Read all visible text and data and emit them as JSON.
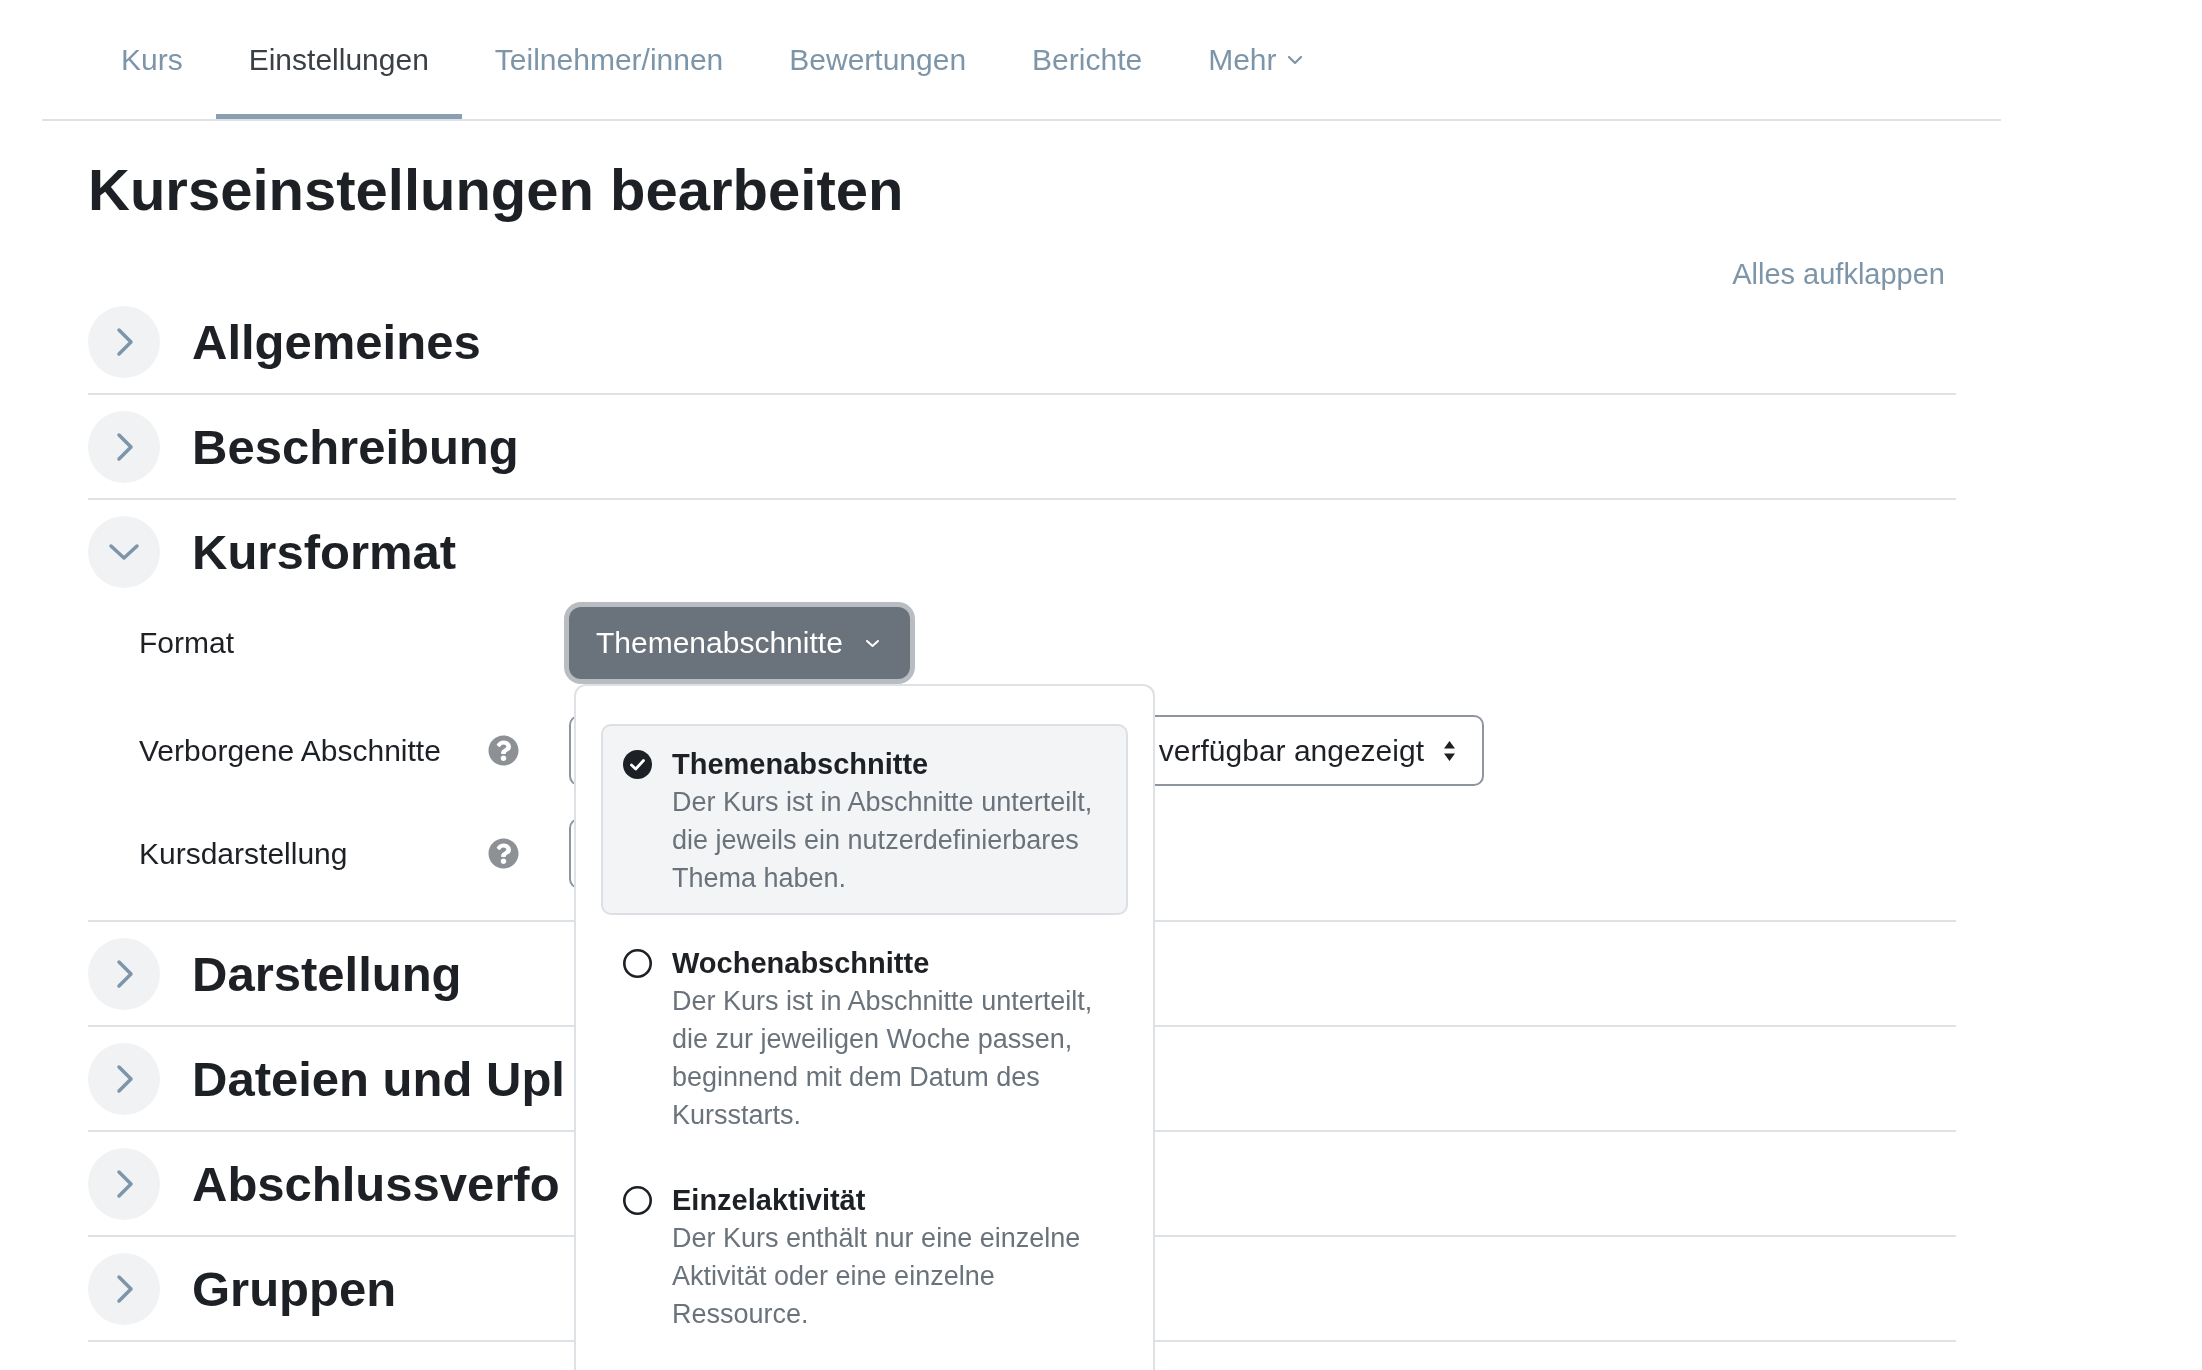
{
  "tabs": [
    {
      "label": "Kurs",
      "selected": false,
      "kind": "link"
    },
    {
      "label": "Einstellungen",
      "selected": true,
      "kind": "link"
    },
    {
      "label": "Teilnehmer/innen",
      "selected": false,
      "kind": "link"
    },
    {
      "label": "Bewertungen",
      "selected": false,
      "kind": "link"
    },
    {
      "label": "Berichte",
      "selected": false,
      "kind": "link"
    },
    {
      "label": "Mehr",
      "selected": false,
      "kind": "menu"
    }
  ],
  "page_title": "Kurseinstellungen bearbeiten",
  "expand_all_link": "Alles aufklappen",
  "sections": [
    {
      "title": "Allgemeines",
      "expanded": false
    },
    {
      "title": "Beschreibung",
      "expanded": false
    },
    {
      "title": "Kursformat",
      "expanded": true,
      "fields": [
        {
          "label": "Format",
          "help": false,
          "control": {
            "kind": "menu-button",
            "value": "Themenabschnitte",
            "expanded": true,
            "options": [
              {
                "title": "Themenabschnitte",
                "description": "Der Kurs ist in Abschnitte unterteilt, die jeweils ein nutzerdefinierbares Thema haben.",
                "selected": true
              },
              {
                "title": "Wochenabschnitte",
                "description": "Der Kurs ist in Abschnitte unterteilt, die zur jeweiligen Woche passen, beginnend mit dem Datum des Kursstarts.",
                "selected": false
              },
              {
                "title": "Einzelaktivität",
                "description": "Der Kurs enthält nur eine einzelne Aktivität oder eine einzelne Ressource.",
                "selected": false
              }
            ]
          }
        },
        {
          "label": "Verborgene Abschnitte",
          "help": true,
          "control": {
            "kind": "select",
            "value": "verfügbar angezeigt"
          }
        },
        {
          "label": "Kursdarstellung",
          "help": true,
          "control": {
            "kind": "select"
          }
        }
      ]
    },
    {
      "title": "Darstellung",
      "expanded": false
    },
    {
      "title": "Dateien und Upl",
      "expanded": false
    },
    {
      "title": "Abschlussverfo",
      "expanded": false
    },
    {
      "title": "Gruppen",
      "expanded": false
    }
  ]
}
